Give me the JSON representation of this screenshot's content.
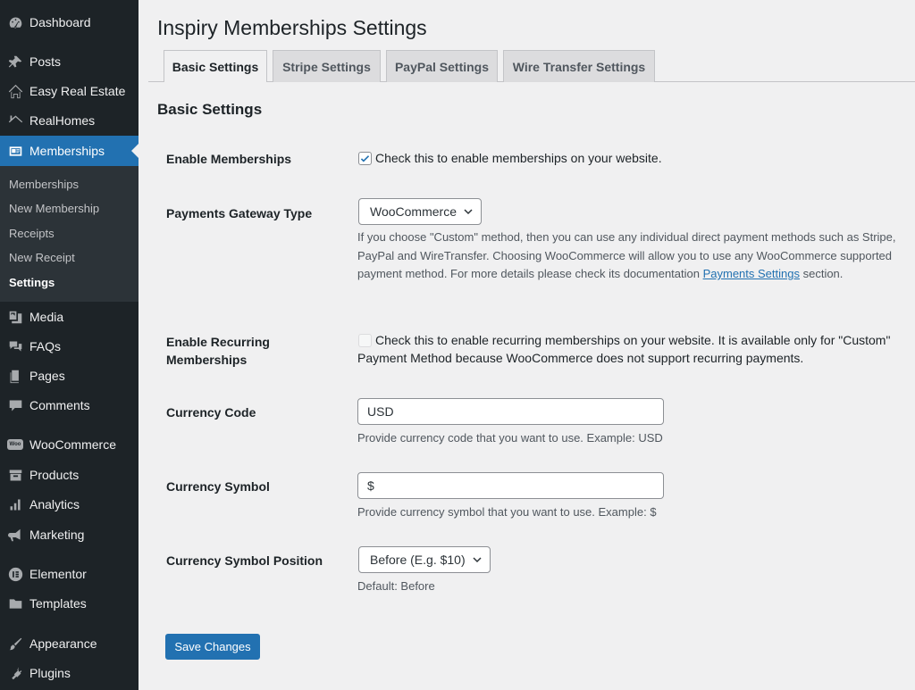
{
  "sidebar": {
    "items": [
      {
        "label": "Dashboard",
        "icon": "dashboard-icon"
      },
      {
        "label": "Posts",
        "icon": "pin-icon"
      },
      {
        "label": "Easy Real Estate",
        "icon": "house-outline-icon"
      },
      {
        "label": "RealHomes",
        "icon": "roof-icon"
      },
      {
        "label": "Memberships",
        "icon": "id-card-icon"
      },
      {
        "label": "Media",
        "icon": "media-icon"
      },
      {
        "label": "FAQs",
        "icon": "speech-bubbles-icon"
      },
      {
        "label": "Pages",
        "icon": "page-icon"
      },
      {
        "label": "Comments",
        "icon": "comment-icon"
      },
      {
        "label": "WooCommerce",
        "icon": "woo-icon"
      },
      {
        "label": "Products",
        "icon": "archive-icon"
      },
      {
        "label": "Analytics",
        "icon": "bar-chart-icon"
      },
      {
        "label": "Marketing",
        "icon": "megaphone-icon"
      },
      {
        "label": "Elementor",
        "icon": "elementor-icon"
      },
      {
        "label": "Templates",
        "icon": "folder-icon"
      },
      {
        "label": "Appearance",
        "icon": "brush-icon"
      },
      {
        "label": "Plugins",
        "icon": "plug-icon"
      }
    ],
    "submenu": [
      "Memberships",
      "New Membership",
      "Receipts",
      "New Receipt",
      "Settings"
    ],
    "woo_badge": "Woo"
  },
  "page": {
    "title": "Inspiry Memberships Settings",
    "tabs": [
      "Basic Settings",
      "Stripe Settings",
      "PayPal Settings",
      "Wire Transfer Settings"
    ],
    "section_title": "Basic Settings"
  },
  "form": {
    "enable_memberships": {
      "label": "Enable Memberships",
      "text": "Check this to enable memberships on your website."
    },
    "gateway": {
      "label": "Payments Gateway Type",
      "value": "WooCommerce",
      "desc_pre": "If you choose \"Custom\" method, then you can use any individual direct payment methods such as Stripe, PayPal and WireTransfer. Choosing WooCommerce will allow you to use any WooCommerce supported payment method. For more details please check its documentation ",
      "desc_link": "Payments Settings",
      "desc_post": " section."
    },
    "recurring": {
      "label": "Enable Recurring Memberships",
      "text": "Check this to enable recurring memberships on your website. It is available only for \"Custom\" Payment Method because WooCommerce does not support recurring payments."
    },
    "currency_code": {
      "label": "Currency Code",
      "value": "USD",
      "desc": "Provide currency code that you want to use. Example: USD"
    },
    "currency_symbol": {
      "label": "Currency Symbol",
      "value": "$",
      "desc": "Provide currency symbol that you want to use. Example: $"
    },
    "symbol_position": {
      "label": "Currency Symbol Position",
      "value": "Before (E.g. $10)",
      "desc": "Default: Before"
    },
    "save_label": "Save Changes"
  }
}
